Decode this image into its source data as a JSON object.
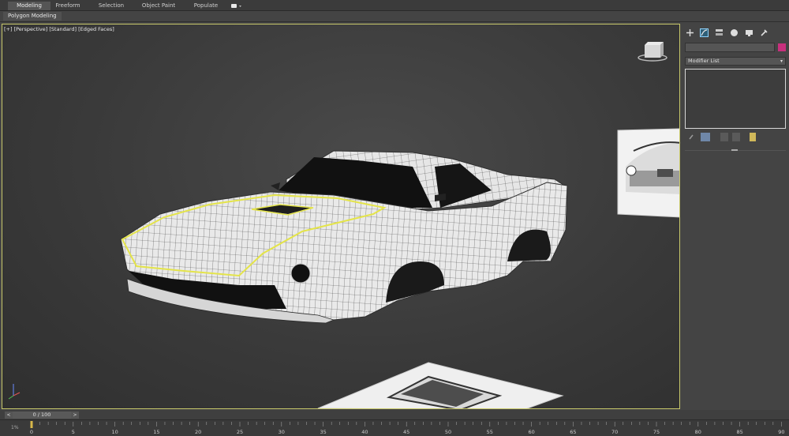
{
  "ribbon": {
    "tabs": [
      "Modeling",
      "Freeform",
      "Selection",
      "Object Paint",
      "Populate"
    ],
    "extra_tab_icon": "camera-dropdown-icon",
    "panel_label": "Polygon Modeling"
  },
  "viewport": {
    "label": "[+] [Perspective] [Standard] [Edged Faces]",
    "selection_color": "#e4e44a",
    "border_color": "#c8c86a"
  },
  "command_panel": {
    "tab_icons": [
      "create-icon",
      "modify-icon",
      "hierarchy-icon",
      "motion-icon",
      "display-icon",
      "utilities-icon"
    ],
    "object_color": "#c8307d",
    "modifier_list_label": "Modifier List"
  },
  "time_slider": {
    "prev": "<",
    "frame_readout": "0 / 100",
    "next": ">"
  },
  "track_bar": {
    "ticks": [
      "0",
      "5",
      "10",
      "15",
      "20",
      "25",
      "30",
      "35",
      "40",
      "45",
      "50",
      "55",
      "60",
      "65",
      "70",
      "75",
      "80",
      "85",
      "90"
    ],
    "left_label": "1%"
  }
}
